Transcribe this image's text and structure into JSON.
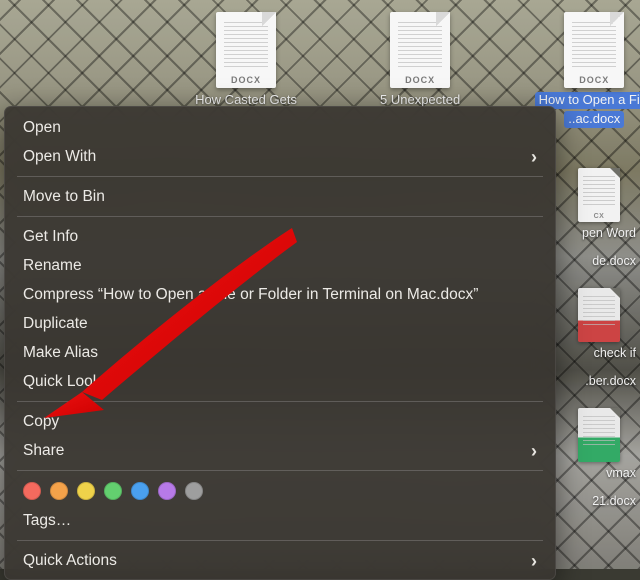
{
  "desktop": {
    "files": [
      {
        "ext": "DOCX",
        "label": "How Casted Gets",
        "selected": false
      },
      {
        "ext": "DOCX",
        "label": "5 Unexpected",
        "selected": false
      },
      {
        "ext": "DOCX",
        "label": "How to Open a File",
        "label2": "..ac.docx",
        "selected": true
      }
    ],
    "edge": [
      {
        "ext": "CX",
        "label": ""
      },
      {
        "ext": "",
        "label": "pen Word"
      },
      {
        "ext": "",
        "label2": "de.docx"
      },
      {
        "ext": "",
        "label": "check if"
      },
      {
        "ext": "",
        "label2": ".ber.docx"
      },
      {
        "ext": "",
        "label": "vmax"
      },
      {
        "ext": "",
        "label2": "21.docx"
      }
    ]
  },
  "menu": {
    "open": "Open",
    "open_with": "Open With",
    "move_to_bin": "Move to Bin",
    "get_info": "Get Info",
    "rename": "Rename",
    "compress": "Compress “How to Open a File or Folder in Terminal on Mac.docx”",
    "duplicate": "Duplicate",
    "make_alias": "Make Alias",
    "quick_look": "Quick Look",
    "copy": "Copy",
    "share": "Share",
    "tags": "Tags…",
    "quick_actions": "Quick Actions"
  },
  "tag_colors": [
    "#f46a5e",
    "#f4a24a",
    "#efd24a",
    "#63cf6f",
    "#4aa0ef",
    "#b77ae8",
    "#9e9e9e"
  ]
}
